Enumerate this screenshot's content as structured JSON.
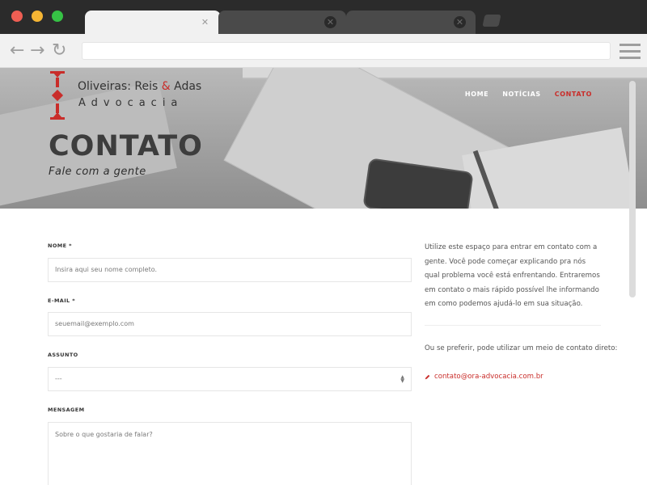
{
  "browser": {
    "colors": {
      "chrome": "#2b2b2b",
      "toolbar": "#f1f1f1"
    }
  },
  "site": {
    "logo_name_part1": "Oliveiras: Reis ",
    "logo_ampersand": "&",
    "logo_name_part2": " Adas",
    "logo_subtitle": "Advocacia",
    "nav": [
      {
        "label": "HOME"
      },
      {
        "label": "NOTÍCIAS"
      },
      {
        "label": "CONTATO",
        "active": true
      }
    ],
    "accent_color": "#c92d2a"
  },
  "hero": {
    "title": "CONTATO",
    "subtitle": "Fale com a gente"
  },
  "form": {
    "name_label": "NOME *",
    "name_placeholder": "Insira aqui seu nome completo.",
    "email_label": "E-MAIL *",
    "email_placeholder": "seuemail@exemplo.com",
    "subject_label": "ASSUNTO",
    "subject_value": "---",
    "message_label": "MENSAGEM",
    "message_placeholder": "Sobre o que gostaria de falar?"
  },
  "info": {
    "intro": "Utilize este espaço para entrar em contato com a gente. Você pode começar explicando pra nós qual problema você está enfrentando. Entraremos em contato o mais rápido possível lhe informando em como podemos ajudá-lo em sua situação.",
    "alt_contact": "Ou se preferir, pode utilizar um meio de contato direto:",
    "email": "contato@ora-advocacia.com.br",
    "email_icon": "pencil-icon"
  }
}
